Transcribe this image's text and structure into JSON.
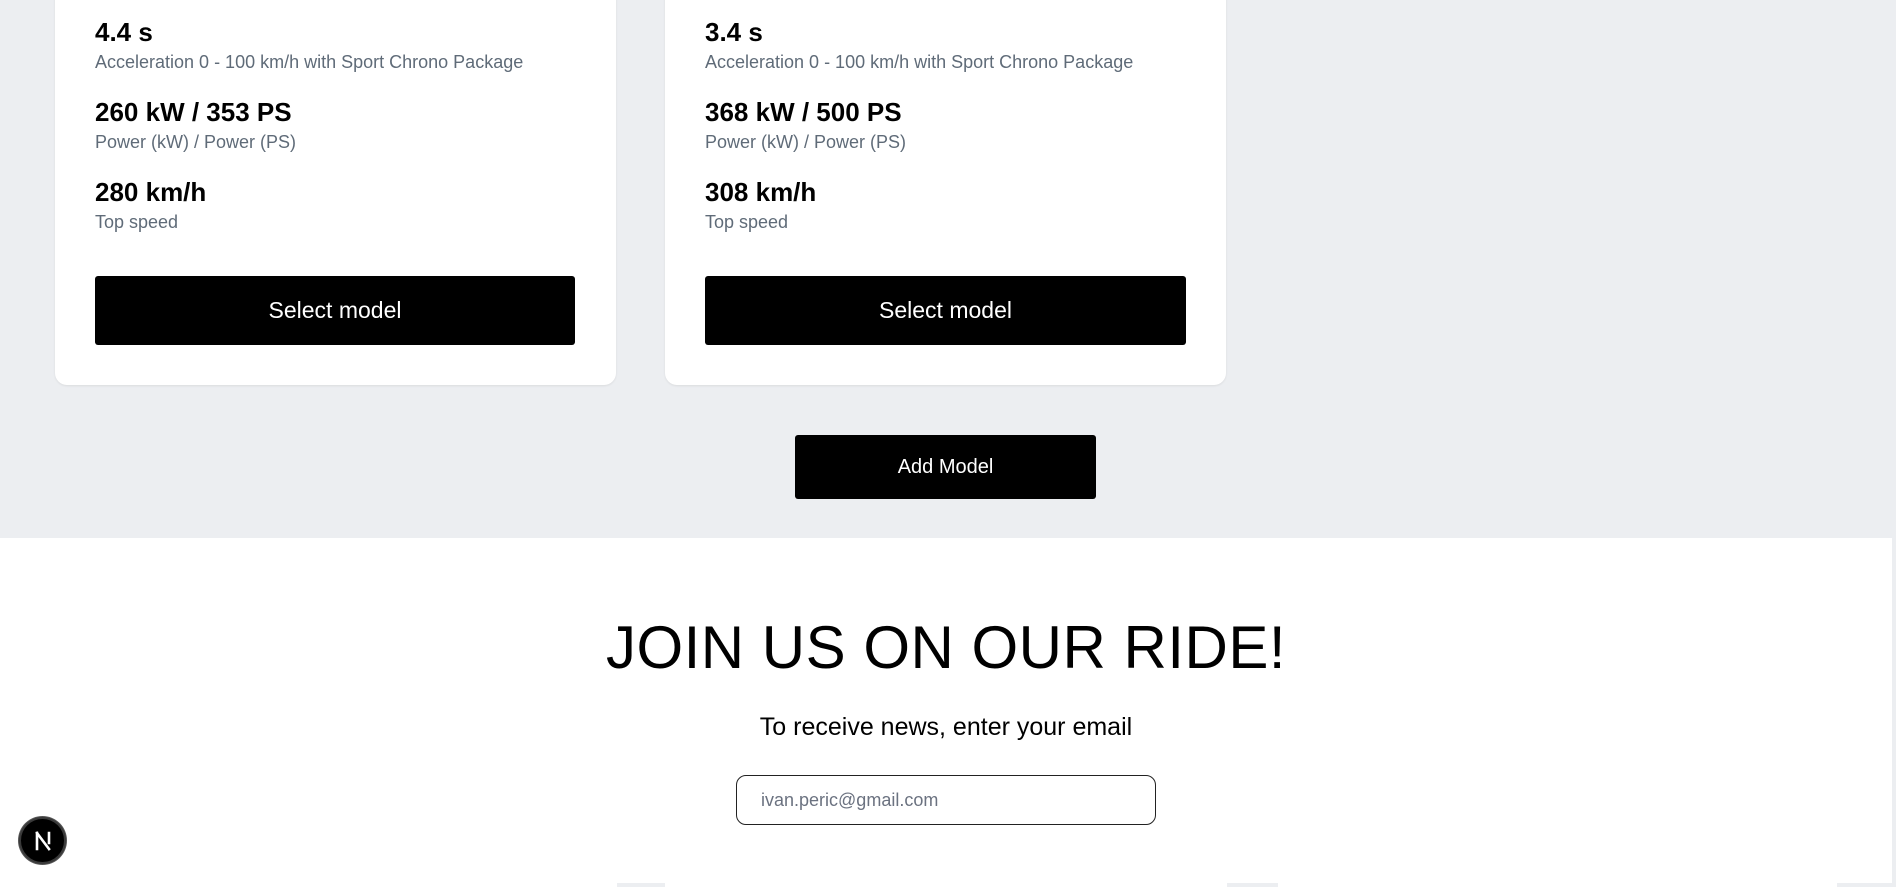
{
  "models": [
    {
      "specs": [
        {
          "value": "4.4 s",
          "label": "Acceleration 0 - 100 km/h with Sport Chrono Package"
        },
        {
          "value": "260 kW / 353 PS",
          "label": "Power (kW) / Power (PS)"
        },
        {
          "value": "280 km/h",
          "label": "Top speed"
        }
      ],
      "button_label": "Select model"
    },
    {
      "specs": [
        {
          "value": "3.4 s",
          "label": "Acceleration 0 - 100 km/h with Sport Chrono Package"
        },
        {
          "value": "368 kW / 500 PS",
          "label": "Power (kW) / Power (PS)"
        },
        {
          "value": "308 km/h",
          "label": "Top speed"
        }
      ],
      "button_label": "Select model"
    }
  ],
  "add_model_label": "Add Model",
  "newsletter": {
    "title": "JOIN US ON OUR RIDE!",
    "subtitle": "To receive news, enter your email",
    "email_placeholder": "ivan.peric@gmail.com"
  },
  "dev_badge": {
    "letter": "N",
    "icon": "nextjs-icon"
  },
  "colors": {
    "page_bg": "#eceef1",
    "card_bg": "#ffffff",
    "button_bg": "#000000",
    "label_gray": "#5f6b78"
  }
}
